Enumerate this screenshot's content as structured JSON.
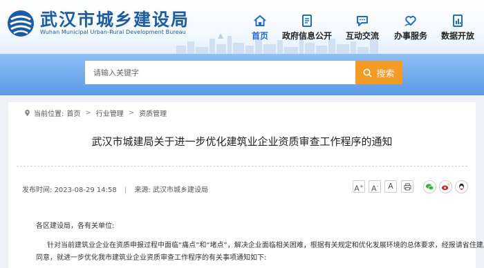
{
  "site": {
    "title": "武汉市城乡建设局",
    "subtitle": "Wuhan Municipal Urban-Rural Development Bureau"
  },
  "nav": [
    {
      "label": "首页",
      "icon": "home-icon",
      "active": true
    },
    {
      "label": "政府信息公开",
      "icon": "document-icon",
      "active": false
    },
    {
      "label": "互动交流",
      "icon": "chat-icon",
      "active": false
    },
    {
      "label": "办事服务",
      "icon": "heart-hand-icon",
      "active": false
    },
    {
      "label": "数据开放",
      "icon": "data-file-icon",
      "active": false
    }
  ],
  "search": {
    "placeholder": "请输入关键字",
    "button_label": "搜索"
  },
  "breadcrumb": {
    "prefix": "当前位置:",
    "items": [
      "首页",
      "行业管理",
      "资质管理"
    ],
    "separator": ">"
  },
  "article": {
    "title": "武汉市城建局关于进一步优化建筑业企业资质审查工作程序的通知",
    "publish_label": "发布时间:",
    "publish_time": "2023-08-29 14:58",
    "source_label": "来源:",
    "source": "武汉市城乡建设局",
    "font_controls": [
      "A+",
      "A-",
      "A"
    ],
    "greeting": "各区建设局，各有关单位:",
    "paragraph_1_line_1": "针对当前建筑业企业在资质申报过程中面临“痛点”和“堵点”，解决企业面临相关困难，根据有关规定和优化发展环境的总体要求，经报请省住建厅",
    "paragraph_1_line_2": "同意，就进一步优化我市建筑业企业资质审查工作程序的有关事项通知如下:"
  },
  "share": [
    "wechat-icon",
    "weibo-icon",
    "qq-icon"
  ],
  "colors": {
    "brand_blue": "#1a5ca8",
    "nav_active": "#1a6dd8",
    "search_orange": "#f59a23",
    "banner_blue": "#5a9ae6"
  }
}
